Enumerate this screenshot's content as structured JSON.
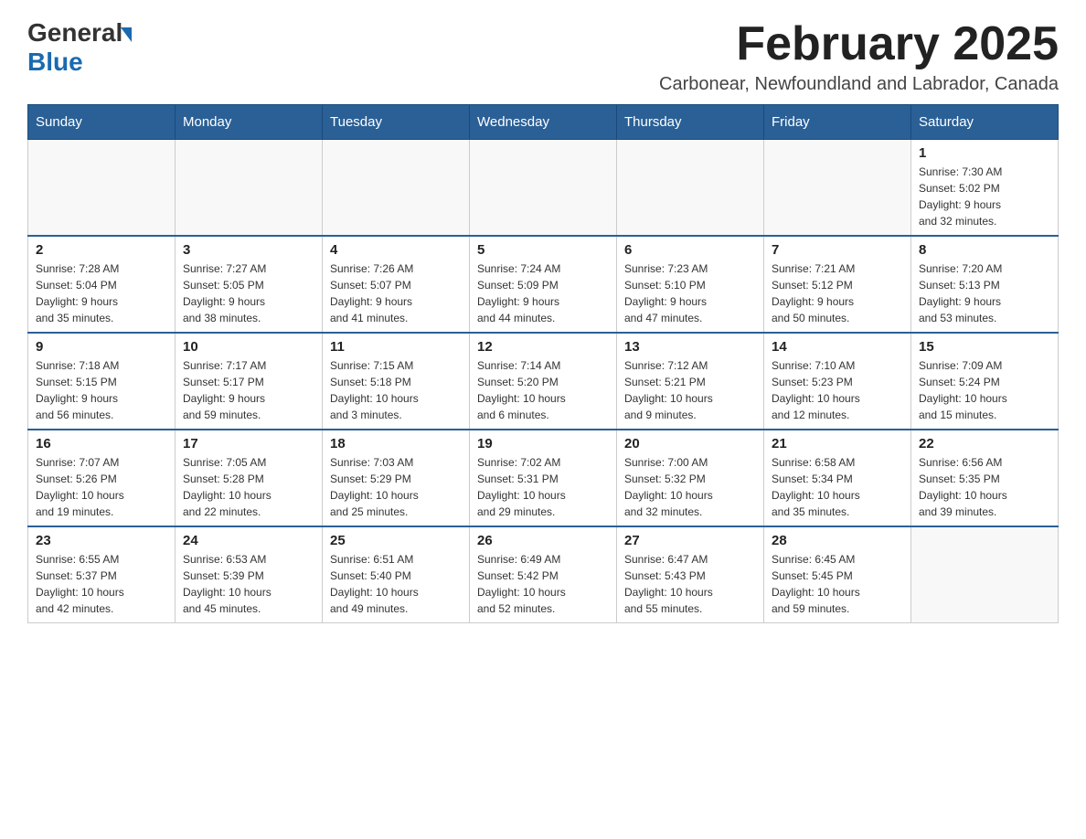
{
  "header": {
    "logo_general": "General",
    "logo_blue": "Blue",
    "month_title": "February 2025",
    "location": "Carbonear, Newfoundland and Labrador, Canada"
  },
  "weekdays": [
    "Sunday",
    "Monday",
    "Tuesday",
    "Wednesday",
    "Thursday",
    "Friday",
    "Saturday"
  ],
  "weeks": [
    {
      "days": [
        {
          "number": "",
          "info": ""
        },
        {
          "number": "",
          "info": ""
        },
        {
          "number": "",
          "info": ""
        },
        {
          "number": "",
          "info": ""
        },
        {
          "number": "",
          "info": ""
        },
        {
          "number": "",
          "info": ""
        },
        {
          "number": "1",
          "info": "Sunrise: 7:30 AM\nSunset: 5:02 PM\nDaylight: 9 hours\nand 32 minutes."
        }
      ]
    },
    {
      "days": [
        {
          "number": "2",
          "info": "Sunrise: 7:28 AM\nSunset: 5:04 PM\nDaylight: 9 hours\nand 35 minutes."
        },
        {
          "number": "3",
          "info": "Sunrise: 7:27 AM\nSunset: 5:05 PM\nDaylight: 9 hours\nand 38 minutes."
        },
        {
          "number": "4",
          "info": "Sunrise: 7:26 AM\nSunset: 5:07 PM\nDaylight: 9 hours\nand 41 minutes."
        },
        {
          "number": "5",
          "info": "Sunrise: 7:24 AM\nSunset: 5:09 PM\nDaylight: 9 hours\nand 44 minutes."
        },
        {
          "number": "6",
          "info": "Sunrise: 7:23 AM\nSunset: 5:10 PM\nDaylight: 9 hours\nand 47 minutes."
        },
        {
          "number": "7",
          "info": "Sunrise: 7:21 AM\nSunset: 5:12 PM\nDaylight: 9 hours\nand 50 minutes."
        },
        {
          "number": "8",
          "info": "Sunrise: 7:20 AM\nSunset: 5:13 PM\nDaylight: 9 hours\nand 53 minutes."
        }
      ]
    },
    {
      "days": [
        {
          "number": "9",
          "info": "Sunrise: 7:18 AM\nSunset: 5:15 PM\nDaylight: 9 hours\nand 56 minutes."
        },
        {
          "number": "10",
          "info": "Sunrise: 7:17 AM\nSunset: 5:17 PM\nDaylight: 9 hours\nand 59 minutes."
        },
        {
          "number": "11",
          "info": "Sunrise: 7:15 AM\nSunset: 5:18 PM\nDaylight: 10 hours\nand 3 minutes."
        },
        {
          "number": "12",
          "info": "Sunrise: 7:14 AM\nSunset: 5:20 PM\nDaylight: 10 hours\nand 6 minutes."
        },
        {
          "number": "13",
          "info": "Sunrise: 7:12 AM\nSunset: 5:21 PM\nDaylight: 10 hours\nand 9 minutes."
        },
        {
          "number": "14",
          "info": "Sunrise: 7:10 AM\nSunset: 5:23 PM\nDaylight: 10 hours\nand 12 minutes."
        },
        {
          "number": "15",
          "info": "Sunrise: 7:09 AM\nSunset: 5:24 PM\nDaylight: 10 hours\nand 15 minutes."
        }
      ]
    },
    {
      "days": [
        {
          "number": "16",
          "info": "Sunrise: 7:07 AM\nSunset: 5:26 PM\nDaylight: 10 hours\nand 19 minutes."
        },
        {
          "number": "17",
          "info": "Sunrise: 7:05 AM\nSunset: 5:28 PM\nDaylight: 10 hours\nand 22 minutes."
        },
        {
          "number": "18",
          "info": "Sunrise: 7:03 AM\nSunset: 5:29 PM\nDaylight: 10 hours\nand 25 minutes."
        },
        {
          "number": "19",
          "info": "Sunrise: 7:02 AM\nSunset: 5:31 PM\nDaylight: 10 hours\nand 29 minutes."
        },
        {
          "number": "20",
          "info": "Sunrise: 7:00 AM\nSunset: 5:32 PM\nDaylight: 10 hours\nand 32 minutes."
        },
        {
          "number": "21",
          "info": "Sunrise: 6:58 AM\nSunset: 5:34 PM\nDaylight: 10 hours\nand 35 minutes."
        },
        {
          "number": "22",
          "info": "Sunrise: 6:56 AM\nSunset: 5:35 PM\nDaylight: 10 hours\nand 39 minutes."
        }
      ]
    },
    {
      "days": [
        {
          "number": "23",
          "info": "Sunrise: 6:55 AM\nSunset: 5:37 PM\nDaylight: 10 hours\nand 42 minutes."
        },
        {
          "number": "24",
          "info": "Sunrise: 6:53 AM\nSunset: 5:39 PM\nDaylight: 10 hours\nand 45 minutes."
        },
        {
          "number": "25",
          "info": "Sunrise: 6:51 AM\nSunset: 5:40 PM\nDaylight: 10 hours\nand 49 minutes."
        },
        {
          "number": "26",
          "info": "Sunrise: 6:49 AM\nSunset: 5:42 PM\nDaylight: 10 hours\nand 52 minutes."
        },
        {
          "number": "27",
          "info": "Sunrise: 6:47 AM\nSunset: 5:43 PM\nDaylight: 10 hours\nand 55 minutes."
        },
        {
          "number": "28",
          "info": "Sunrise: 6:45 AM\nSunset: 5:45 PM\nDaylight: 10 hours\nand 59 minutes."
        },
        {
          "number": "",
          "info": ""
        }
      ]
    }
  ]
}
